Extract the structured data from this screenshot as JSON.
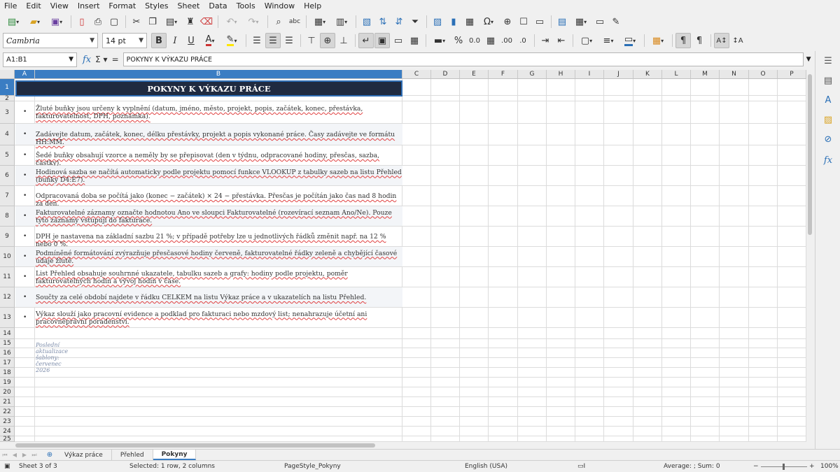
{
  "menu": [
    "File",
    "Edit",
    "View",
    "Insert",
    "Format",
    "Styles",
    "Sheet",
    "Data",
    "Tools",
    "Window",
    "Help"
  ],
  "format_toolbar": {
    "font_name": "Cambria",
    "font_size": "14 pt",
    "bold": "B",
    "italic": "I",
    "underline": "U"
  },
  "formula_bar": {
    "name_box": "A1:B1",
    "formula": "POKYNY K VÝKAZU PRÁCE"
  },
  "columns": [
    "A",
    "B",
    "C",
    "D",
    "E",
    "F",
    "G",
    "H",
    "I",
    "J",
    "K",
    "L",
    "M",
    "N",
    "O",
    "P"
  ],
  "rows": [
    "1",
    "2",
    "3",
    "4",
    "5",
    "6",
    "7",
    "8",
    "9",
    "10",
    "11",
    "12",
    "13",
    "14",
    "15",
    "16",
    "17",
    "18",
    "19",
    "20",
    "21",
    "22",
    "23",
    "24",
    "25"
  ],
  "sheet": {
    "title": "POKYNY K VÝKAZU PRÁCE",
    "instructions": [
      "Žluté buňky jsou určeny k vyplnění (datum, jméno, město, projekt, popis, začátek, konec, přestávka, fakturovatelnost, DPH, poznámka).",
      "Zadávejte datum, začátek, konec, délku přestávky, projekt a popis vykonané práce. Časy zadávejte ve formátu HH:MM.",
      "Šedé buňky obsahují vzorce a neměly by se přepisovat (den v týdnu, odpracované hodiny, přesčas, sazba, částky).",
      "Hodinová sazba se načítá automaticky podle projektu pomocí funkce VLOOKUP z tabulky sazeb na listu Přehled (buňky D4:E7).",
      "Odpracovaná doba se počítá jako (konec − začátek) × 24 − přestávka. Přesčas je počítán jako čas nad 8 hodin za den.",
      "Fakturovatelné záznamy označte hodnotou Ano ve sloupci Fakturovatelné (rozevírací seznam Ano/Ne). Pouze tyto záznamy vstupují do fakturace.",
      "DPH je nastavena na základní sazbu 21 %; v případě potřeby lze u jednotlivých řádků změnit např. na 12 % nebo 0 %.",
      "Podmíněné formátování zvýrazňuje přesčasové hodiny červeně, fakturovatelné řádky zeleně a chybějící časové údaje žlutě.",
      "List Přehled obsahuje souhrnné ukazatele, tabulku sazeb a grafy: hodiny podle projektu, poměr fakturovatelných hodin a vývoj hodin v čase.",
      "Součty za celé období najdete v řádku CELKEM na listu Výkaz práce a v ukazatelích na listu Přehled.",
      "Výkaz slouží jako pracovní evidence a podklad pro fakturaci nebo mzdový list; nenahrazuje účetní ani pracovněprávní poradenství."
    ],
    "footnote": "Poslední aktualizace šablony: červenec 2026"
  },
  "tabs": [
    "Výkaz práce",
    "Přehled",
    "Pokyny"
  ],
  "active_tab": "Pokyny",
  "status": {
    "sheet": "Sheet 3 of 3",
    "selection": "Selected: 1 row, 2 columns",
    "page_style": "PageStyle_Pokyny",
    "language": "English (USA)",
    "summary": "Average: ; Sum: 0",
    "zoom": "100%"
  },
  "colors": {
    "title_bg": "#1f2a40",
    "selection_blue": "#3a7dc3"
  }
}
